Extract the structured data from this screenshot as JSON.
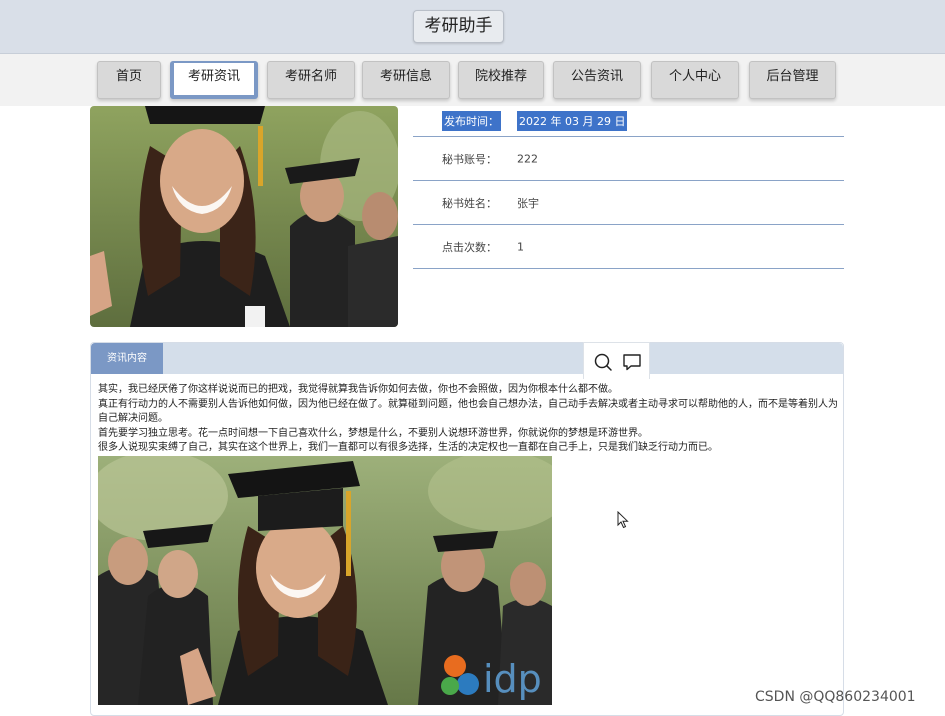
{
  "header": {
    "title": "考研助手"
  },
  "nav": {
    "items": [
      {
        "label": "首页",
        "active": false
      },
      {
        "label": "考研资讯",
        "active": true
      },
      {
        "label": "考研名师",
        "active": false
      },
      {
        "label": "考研信息",
        "active": false
      },
      {
        "label": "院校推荐",
        "active": false
      },
      {
        "label": "公告资讯",
        "active": false
      },
      {
        "label": "个人中心",
        "active": false
      },
      {
        "label": "后台管理",
        "active": false
      }
    ]
  },
  "detail": {
    "rows": [
      {
        "label": "发布时间：",
        "value": "2022 年 03 月 29 日",
        "selected": true
      },
      {
        "label": "秘书账号：",
        "value": "222",
        "selected": false
      },
      {
        "label": "秘书姓名：",
        "value": "张宇",
        "selected": false
      },
      {
        "label": "点击次数：",
        "value": "1",
        "selected": false
      }
    ]
  },
  "content": {
    "tab_label": "资讯内容",
    "paragraphs": [
      "其实，我已经厌倦了你这样说说而已的把戏，我觉得就算我告诉你如何去做，你也不会照做，因为你根本什么都不做。",
      "真正有行动力的人不需要别人告诉他如何做，因为他已经在做了。就算碰到问题，他也会自己想办法，自己动手去解决或者主动寻求可以帮助他的人，而不是等着别人为自己解决问题。",
      "首先要学习独立思考。花一点时间想一下自己喜欢什么，梦想是什么，不要别人说想环游世界，你就说你的梦想是环游世界。",
      "很多人说现实束缚了自己，其实在这个世界上，我们一直都可以有很多选择，生活的决定权也一直都在自己手上，只是我们缺乏行动力而已。"
    ]
  },
  "photo_logo_text": "idp",
  "watermark": "CSDN @QQ860234001",
  "colors": {
    "accent": "#7b98c5",
    "header_bg": "#d9dfe8",
    "selection": "#3e73c9",
    "divider": "#8aa3c7"
  },
  "icons": [
    "search-icon",
    "comment-icon",
    "mouse-cursor-icon"
  ]
}
